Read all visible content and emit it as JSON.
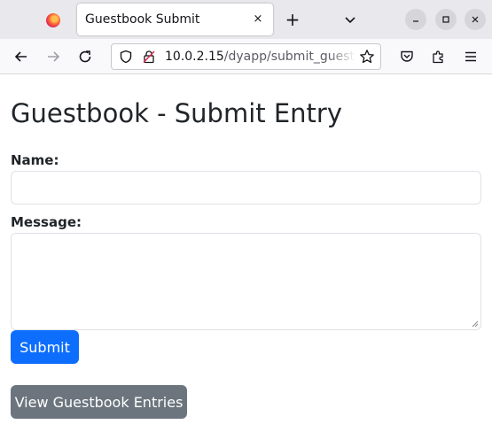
{
  "browser": {
    "tab_title": "Guestbook Submit",
    "new_tab_symbol": "+",
    "close_symbol": "×",
    "url_host": "10.0.2.15",
    "url_path": "/dyapp/submit_guest"
  },
  "page": {
    "title": "Guestbook - Submit Entry",
    "name_label": "Name:",
    "message_label": "Message:",
    "name_value": "",
    "message_value": "",
    "submit_label": "Submit",
    "view_label": "View Guestbook Entries"
  },
  "colors": {
    "primary": "#0d6efd",
    "secondary": "#6c757d"
  }
}
